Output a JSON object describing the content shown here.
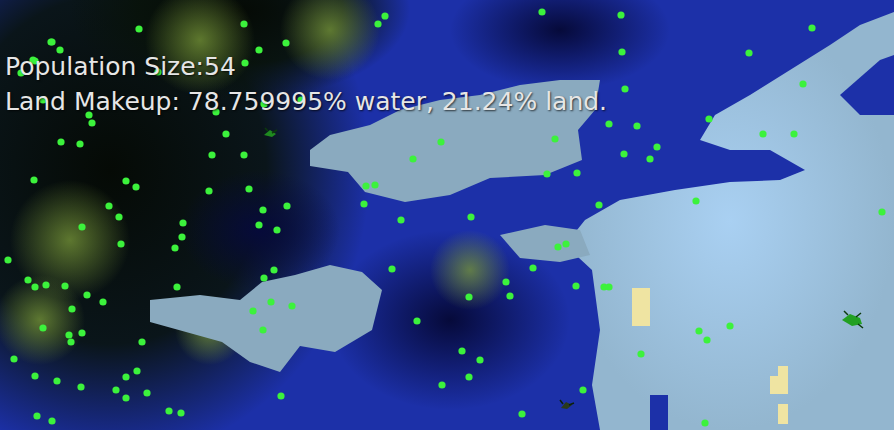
{
  "hud": {
    "population": "Population Size:54",
    "land_makeup": "Land Makeup: 78.759995% water, 21.24% land."
  }
}
